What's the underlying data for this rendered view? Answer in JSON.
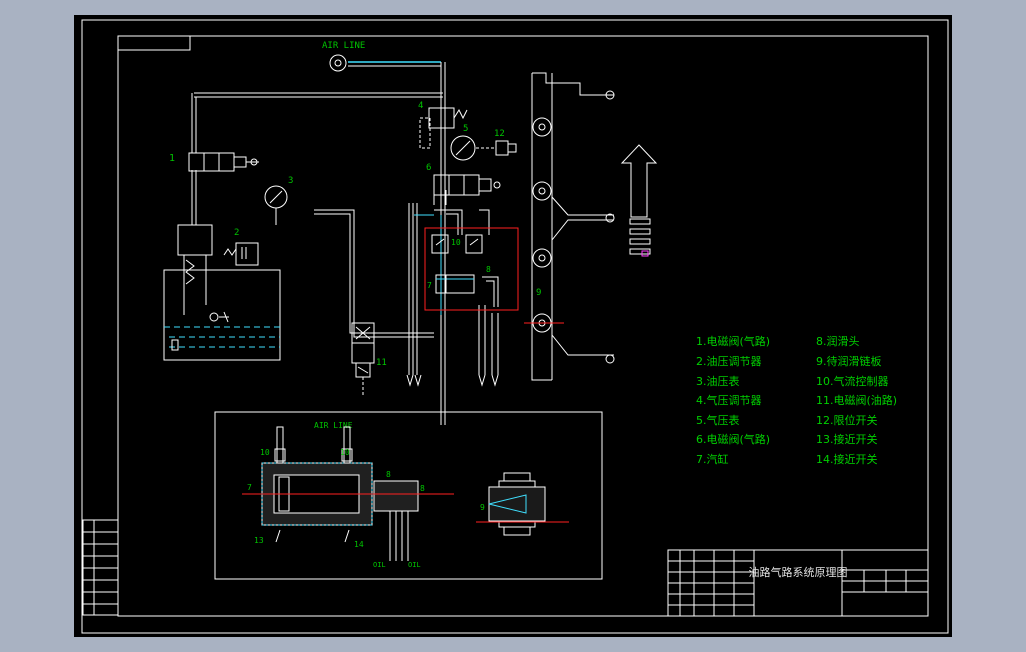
{
  "drawing": {
    "title": "油路气路系统原理图",
    "air_line": "AIR LINE",
    "oil": "OIL",
    "part_numbers": [
      "1",
      "2",
      "3",
      "4",
      "5",
      "6",
      "7",
      "8",
      "9",
      "10",
      "11",
      "12",
      "13",
      "14"
    ]
  },
  "legend": [
    "1.电磁阀(气路)",
    "2.油压调节器",
    "3.油压表",
    "4.气压调节器",
    "5.气压表",
    "6.电磁阀(气路)",
    "7.汽缸",
    "8.润滑头",
    "9.待润滑链板",
    "10.气流控制器",
    "11.电磁阀(油路)",
    "12.限位开关",
    "13.接近开关",
    "14.接近开关"
  ],
  "colors": {
    "background": "#000000",
    "frame": "#ffffff",
    "label": "#00c400",
    "air_line": "#40e0ff",
    "highlight": "#ff2020",
    "accent": "#ff40ff"
  }
}
